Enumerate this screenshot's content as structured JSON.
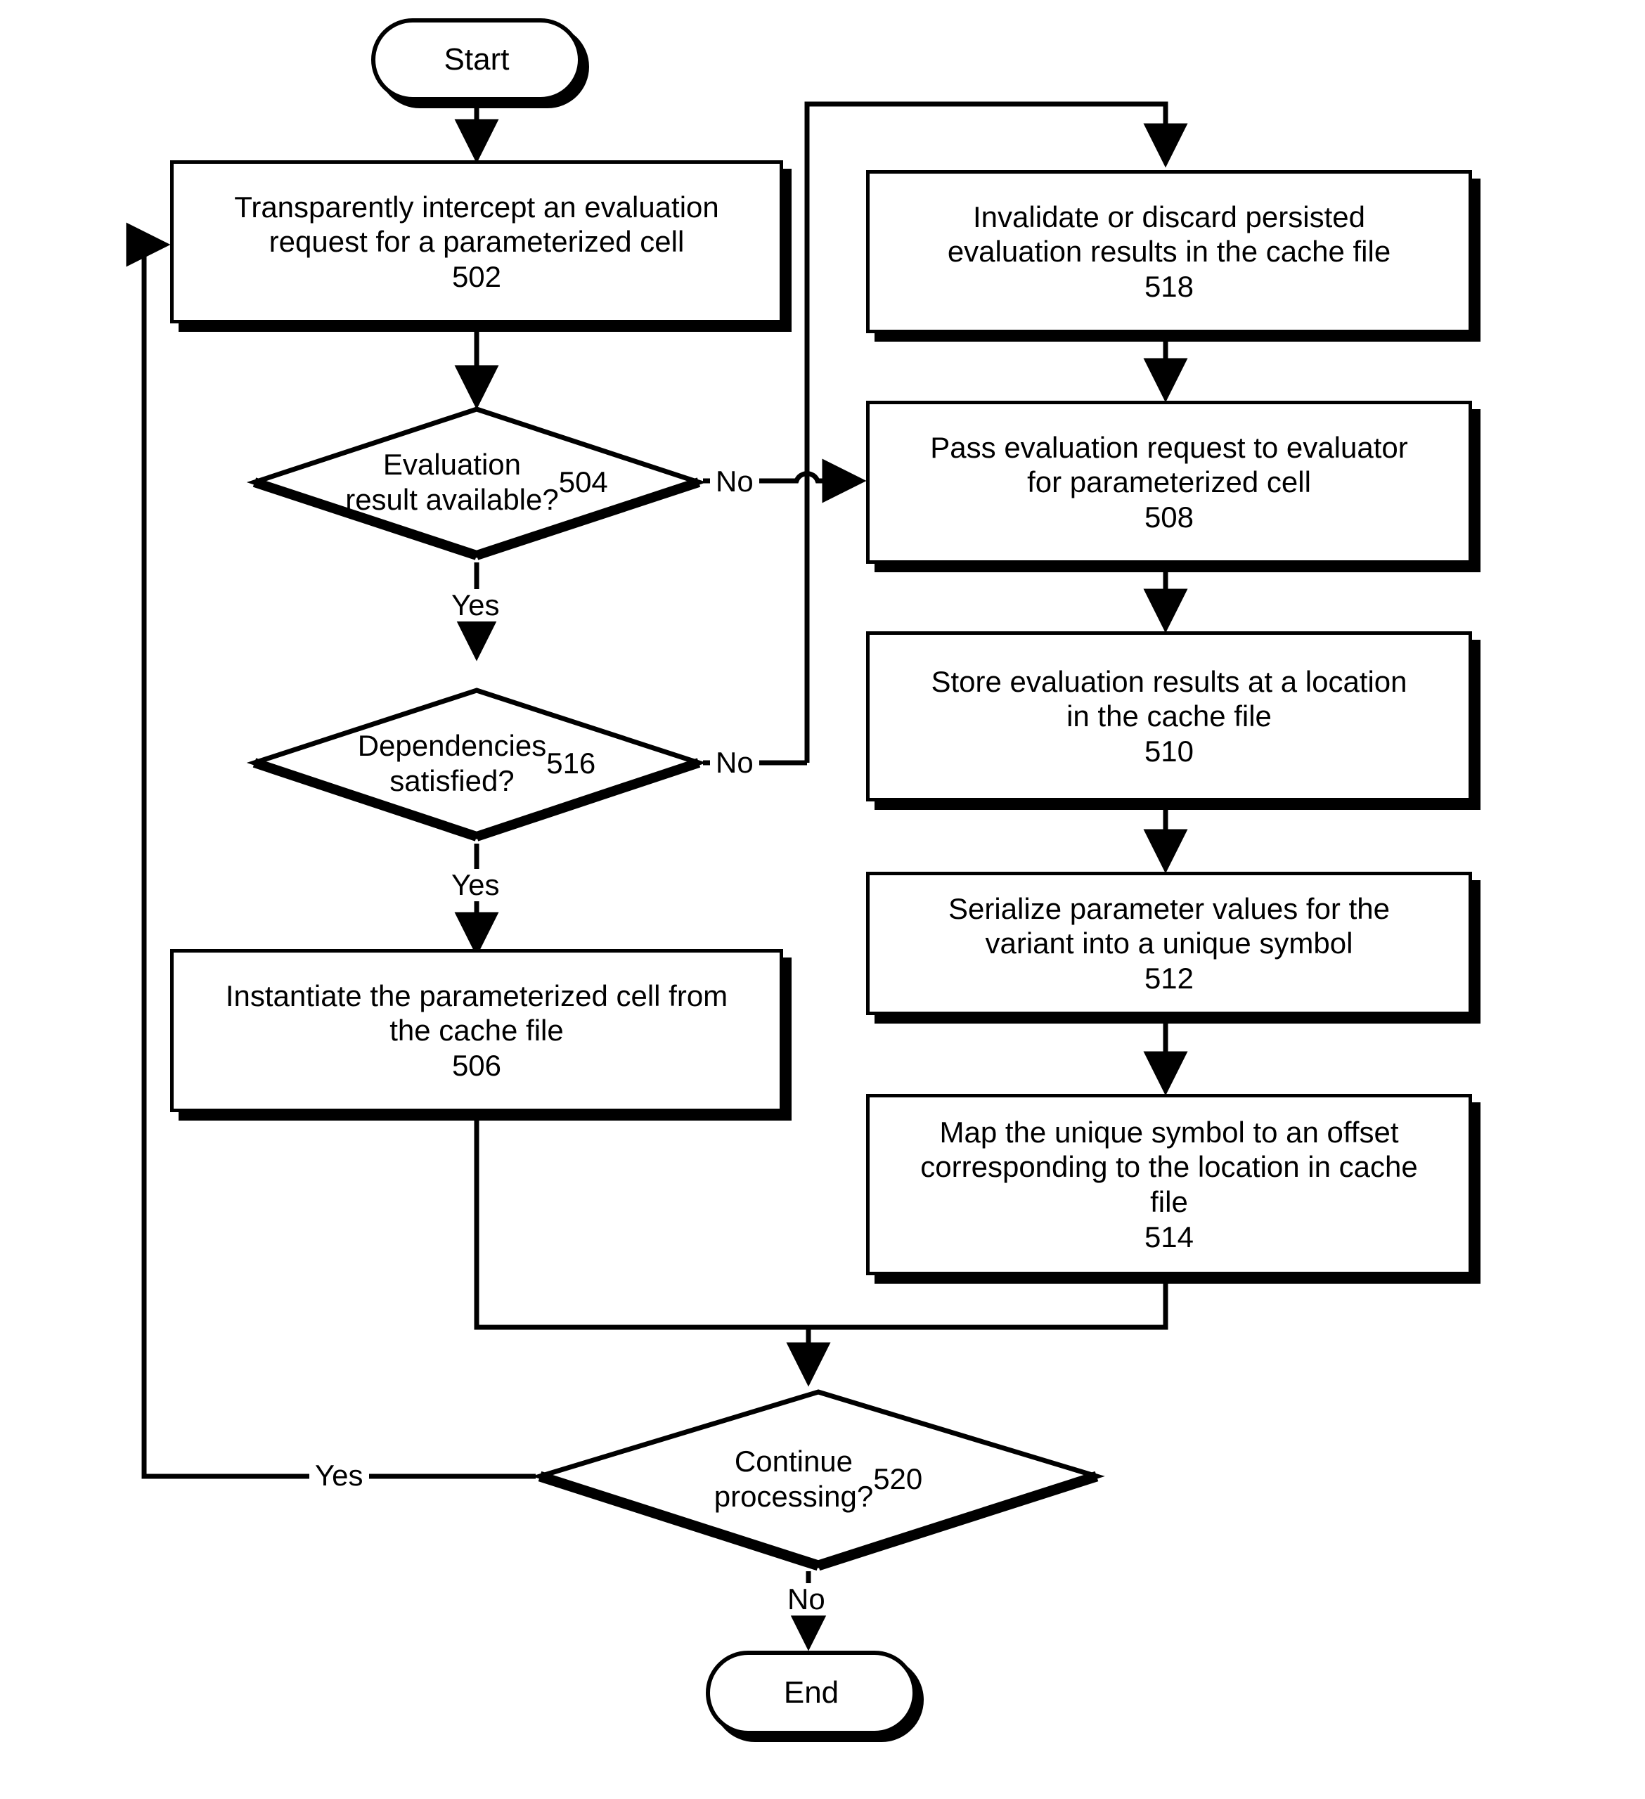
{
  "diagram": {
    "title": "Parameterized cell evaluation caching flowchart",
    "stroke_color": "#000000",
    "fill_color": "#ffffff",
    "background": "#ffffff"
  },
  "nodes": {
    "start": {
      "label": "Start",
      "shape": "terminator"
    },
    "end": {
      "label": "End",
      "shape": "terminator"
    },
    "n502": {
      "text": "Transparently intercept an evaluation\nrequest for a parameterized cell",
      "ref": "502",
      "shape": "process"
    },
    "n504": {
      "text": "Evaluation\nresult available?",
      "ref": "504",
      "shape": "decision"
    },
    "n516": {
      "text": "Dependencies\nsatisfied?",
      "ref": "516",
      "shape": "decision"
    },
    "n506": {
      "text": "Instantiate the parameterized cell from\nthe cache file",
      "ref": "506",
      "shape": "process"
    },
    "n518": {
      "text": "Invalidate or discard persisted\nevaluation results in the cache file",
      "ref": "518",
      "shape": "process"
    },
    "n508": {
      "text": "Pass evaluation request to evaluator\nfor parameterized cell",
      "ref": "508",
      "shape": "process"
    },
    "n510": {
      "text": "Store evaluation results at a location\nin the cache file",
      "ref": "510",
      "shape": "process"
    },
    "n512": {
      "text": "Serialize parameter values for the\nvariant into a unique symbol",
      "ref": "512",
      "shape": "process"
    },
    "n514": {
      "text": "Map the unique symbol to an offset\ncorresponding to the location in cache\nfile",
      "ref": "514",
      "shape": "process"
    },
    "n520": {
      "text": "Continue\nprocessing?",
      "ref": "520",
      "shape": "decision"
    }
  },
  "edge_labels": {
    "e504_no": "No",
    "e504_yes": "Yes",
    "e516_no": "No",
    "e516_yes": "Yes",
    "e520_yes": "Yes",
    "e520_no": "No"
  },
  "chart_data": {
    "type": "flowchart",
    "title": "Parameterized cell evaluation caching flowchart",
    "nodes": [
      {
        "id": "start",
        "label": "Start",
        "type": "terminator"
      },
      {
        "id": "502",
        "label": "Transparently intercept an evaluation request for a parameterized cell",
        "type": "process"
      },
      {
        "id": "504",
        "label": "Evaluation result available?",
        "type": "decision"
      },
      {
        "id": "516",
        "label": "Dependencies satisfied?",
        "type": "decision"
      },
      {
        "id": "506",
        "label": "Instantiate the parameterized cell from the cache file",
        "type": "process"
      },
      {
        "id": "518",
        "label": "Invalidate or discard persisted evaluation results in the cache file",
        "type": "process"
      },
      {
        "id": "508",
        "label": "Pass evaluation request to evaluator for parameterized cell",
        "type": "process"
      },
      {
        "id": "510",
        "label": "Store evaluation results at a location in the cache file",
        "type": "process"
      },
      {
        "id": "512",
        "label": "Serialize parameter values for the variant into a unique symbol",
        "type": "process"
      },
      {
        "id": "514",
        "label": "Map the unique symbol to an offset corresponding to the location in cache file",
        "type": "process"
      },
      {
        "id": "520",
        "label": "Continue processing?",
        "type": "decision"
      },
      {
        "id": "end",
        "label": "End",
        "type": "terminator"
      }
    ],
    "edges": [
      {
        "from": "start",
        "to": "502",
        "label": ""
      },
      {
        "from": "502",
        "to": "504",
        "label": ""
      },
      {
        "from": "504",
        "to": "508",
        "label": "No"
      },
      {
        "from": "504",
        "to": "516",
        "label": "Yes"
      },
      {
        "from": "516",
        "to": "518",
        "label": "No"
      },
      {
        "from": "516",
        "to": "506",
        "label": "Yes"
      },
      {
        "from": "518",
        "to": "508",
        "label": ""
      },
      {
        "from": "508",
        "to": "510",
        "label": ""
      },
      {
        "from": "510",
        "to": "512",
        "label": ""
      },
      {
        "from": "512",
        "to": "514",
        "label": ""
      },
      {
        "from": "514",
        "to": "520",
        "label": ""
      },
      {
        "from": "506",
        "to": "520",
        "label": ""
      },
      {
        "from": "520",
        "to": "502",
        "label": "Yes"
      },
      {
        "from": "520",
        "to": "end",
        "label": "No"
      }
    ]
  }
}
